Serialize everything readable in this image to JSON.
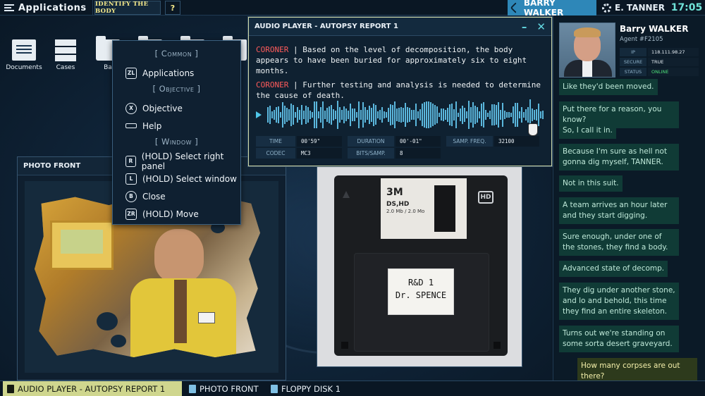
{
  "topbar": {
    "apps_label": "Applications",
    "objective_label": "IDENTIFY THE BODY",
    "help_label": "?",
    "call_name": "BARRY WALKER",
    "user_name": "E. TANNER",
    "time": "17:05"
  },
  "desktop_icons": [
    {
      "label": "Documents"
    },
    {
      "label": "Cases"
    },
    {
      "label": "Ba"
    },
    {
      "label": ""
    },
    {
      "label": ""
    },
    {
      "label": ""
    }
  ],
  "context_menu": {
    "header_common": "[ Common ]",
    "applications": {
      "key": "ZL",
      "label": "Applications"
    },
    "header_objective": "[ Objective ]",
    "objective": {
      "key": "X",
      "label": "Objective"
    },
    "help": {
      "key": "",
      "label": "Help"
    },
    "header_window": "[ Window ]",
    "select_right": {
      "key": "R",
      "label": "(HOLD) Select right panel"
    },
    "select_window": {
      "key": "L",
      "label": "(HOLD) Select window"
    },
    "close": {
      "key": "B",
      "label": "Close"
    },
    "move": {
      "key": "ZR",
      "label": "(HOLD) Move"
    }
  },
  "photo_window": {
    "title": "PHOTO FRONT"
  },
  "floppy": {
    "brand": "3M",
    "type": "DS,HD",
    "capacity": "2.0 Mb / 2.0 Mo",
    "hd_mark": "HD",
    "label_line1": "R&D 1",
    "label_line2": "Dr. SPENCE"
  },
  "audio_player": {
    "title": "AUDIO PLAYER - AUTOPSY REPORT 1",
    "minimize": "–",
    "close": "✕",
    "lines": [
      {
        "speaker": "CORONER",
        "text": " | Based on the level of decomposition, the body appears to have been buried for approximately six to eight months."
      },
      {
        "speaker": "CORONER",
        "text": " | Further testing and analysis is needed to determine the cause of death."
      }
    ],
    "progress": 0.95,
    "meta": {
      "time_label": "TIME",
      "time_value": "00'59\"",
      "duration_label": "DURATION",
      "duration_value": "00'-01\"",
      "freq_label": "SAMP. FREQ.",
      "freq_value": "32100",
      "codec_label": "CODEC",
      "codec_value": "MC3",
      "bits_label": "BITS/SAMP.",
      "bits_value": "8"
    }
  },
  "agent": {
    "name": "Barry WALKER",
    "id": "Agent #F2105",
    "ip_label": "IP",
    "ip_value": "118.111.98.27",
    "secure_label": "SECURE",
    "secure_value": "TRUE",
    "status_label": "STATUS",
    "status_value": "ONLINE"
  },
  "chat": [
    {
      "text": "Like they'd been moved.",
      "from": "agent"
    },
    {
      "text": "Put there for a reason, you know?",
      "from": "agent"
    },
    {
      "text": "So, I call it in.",
      "from": "agent"
    },
    {
      "text": "Because I'm sure as hell not gonna dig myself, TANNER.",
      "from": "agent"
    },
    {
      "text": "Not in this suit.",
      "from": "agent"
    },
    {
      "text": "A team arrives an hour later and they start digging.",
      "from": "agent"
    },
    {
      "text": "Sure enough, under one of the stones, they find a body.",
      "from": "agent"
    },
    {
      "text": "Advanced state of decomp.",
      "from": "agent"
    },
    {
      "text": "They dig under another stone, and lo and behold, this time they find an entire skeleton.",
      "from": "agent"
    },
    {
      "text": "Turns out we're standing on some sorta desert graveyard.",
      "from": "agent"
    },
    {
      "text": "How many corpses are out there?",
      "from": "me"
    }
  ],
  "taskbar": [
    {
      "label": "AUDIO PLAYER - AUTOPSY REPORT 1",
      "active": true
    },
    {
      "label": "PHOTO FRONT",
      "active": false
    },
    {
      "label": "FLOPPY DISK 1",
      "active": false
    }
  ]
}
